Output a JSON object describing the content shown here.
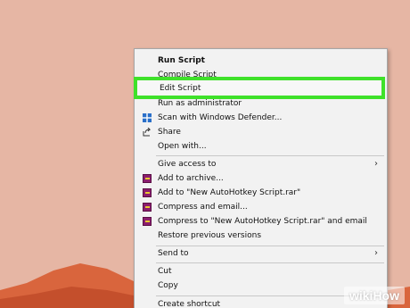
{
  "menu": {
    "items": [
      {
        "label": "Run Script",
        "bold": true
      },
      {
        "label": "Compile Script"
      },
      {
        "label": "Run as administrator"
      },
      {
        "label": "Scan with Windows Defender..."
      },
      {
        "label": "Share"
      },
      {
        "label": "Open with..."
      },
      {
        "label": "Give access to"
      },
      {
        "label": "Add to archive..."
      },
      {
        "label": "Add to \"New AutoHotkey Script.rar\""
      },
      {
        "label": "Compress and email..."
      },
      {
        "label": "Compress to \"New AutoHotkey Script.rar\" and email"
      },
      {
        "label": "Restore previous versions"
      },
      {
        "label": "Send to"
      },
      {
        "label": "Cut"
      },
      {
        "label": "Copy"
      },
      {
        "label": "Create shortcut"
      }
    ],
    "highlighted": {
      "label": "Edit Script"
    },
    "highlight_color": "#3fe12a"
  },
  "watermark": {
    "wiki": "wiki",
    "how": "How"
  }
}
